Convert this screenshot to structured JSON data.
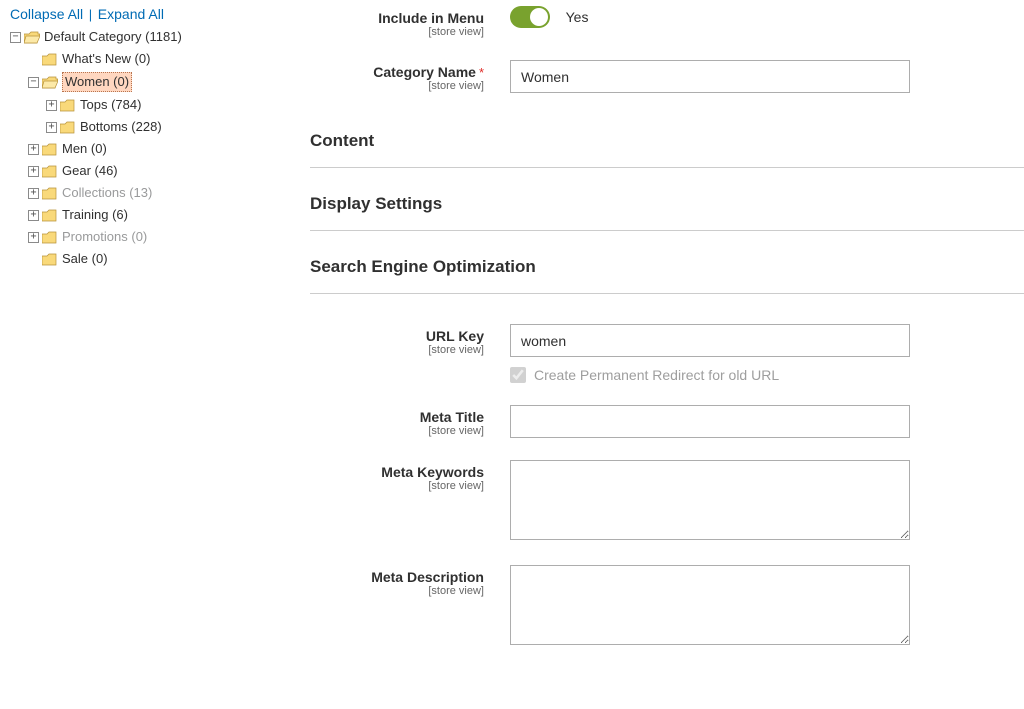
{
  "sidebar": {
    "collapse_label": "Collapse All",
    "expand_label": "Expand All",
    "tree": {
      "root": {
        "label": "Default Category (1181)"
      },
      "whats_new": {
        "label": "What's New (0)"
      },
      "women": {
        "label": "Women (0)"
      },
      "tops": {
        "label": "Tops (784)"
      },
      "bottoms": {
        "label": "Bottoms (228)"
      },
      "men": {
        "label": "Men (0)"
      },
      "gear": {
        "label": "Gear (46)"
      },
      "collections": {
        "label": "Collections (13)"
      },
      "training": {
        "label": "Training (6)"
      },
      "promotions": {
        "label": "Promotions (0)"
      },
      "sale": {
        "label": "Sale (0)"
      }
    }
  },
  "form": {
    "include_in_menu": {
      "label": "Include in Menu",
      "sub": "[store view]",
      "toggle_value": "Yes"
    },
    "category_name": {
      "label": "Category Name",
      "sub": "[store view]",
      "value": "Women"
    },
    "sections": {
      "content": "Content",
      "display": "Display Settings",
      "seo": "Search Engine Optimization"
    },
    "seo": {
      "url_key": {
        "label": "URL Key",
        "sub": "[store view]",
        "value": "women"
      },
      "redirect_label": "Create Permanent Redirect for old URL",
      "meta_title": {
        "label": "Meta Title",
        "sub": "[store view]",
        "value": ""
      },
      "meta_keywords": {
        "label": "Meta Keywords",
        "sub": "[store view]",
        "value": ""
      },
      "meta_description": {
        "label": "Meta Description",
        "sub": "[store view]",
        "value": ""
      }
    }
  },
  "toggles": {
    "minus": "−",
    "plus": "+"
  }
}
